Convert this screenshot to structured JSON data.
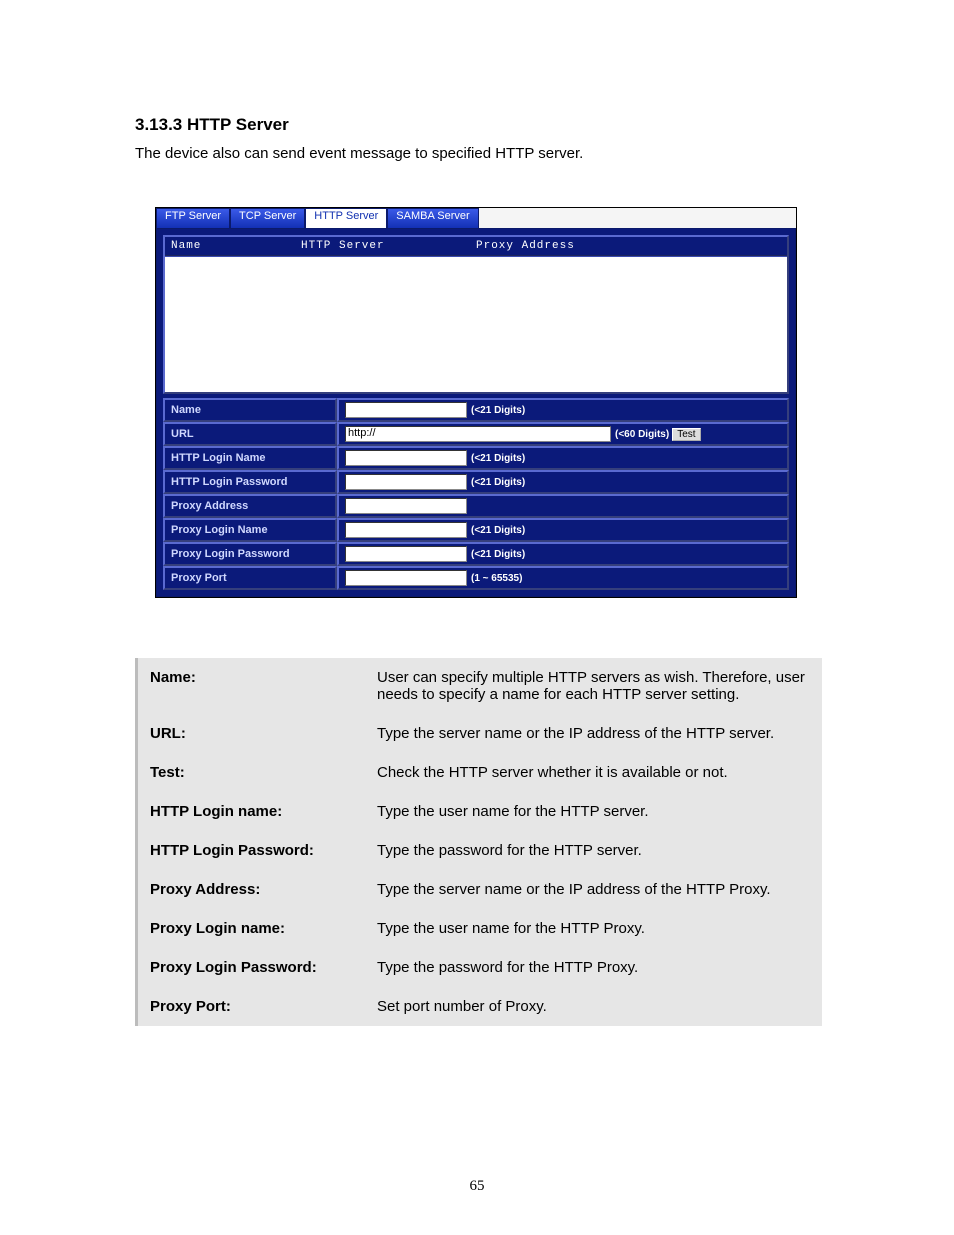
{
  "heading": "3.13.3 HTTP Server",
  "intro": "The device also can send event message to specified HTTP server.",
  "tabs": [
    "FTP Server",
    "TCP Server",
    "HTTP Server",
    "SAMBA Server"
  ],
  "active_tab_index": 2,
  "list_header": {
    "c1": "Name",
    "c2": "HTTP Server",
    "c3": "Proxy Address"
  },
  "form_rows": [
    {
      "label": "Name",
      "value": "",
      "hint": "(<21 Digits)",
      "input_w": 120
    },
    {
      "label": "URL",
      "value": "http://",
      "hint": "(<60 Digits)",
      "input_w": 260,
      "test": "Test"
    },
    {
      "label": "HTTP Login Name",
      "value": "",
      "hint": "(<21 Digits)",
      "input_w": 120
    },
    {
      "label": "HTTP Login Password",
      "value": "",
      "hint": "(<21 Digits)",
      "input_w": 120
    },
    {
      "label": "Proxy Address",
      "value": "",
      "hint": "",
      "input_w": 120
    },
    {
      "label": "Proxy Login Name",
      "value": "",
      "hint": "(<21 Digits)",
      "input_w": 120
    },
    {
      "label": "Proxy Login Password",
      "value": "",
      "hint": "(<21 Digits)",
      "input_w": 120
    },
    {
      "label": "Proxy Port",
      "value": "",
      "hint": "(1 ~ 65535)",
      "input_w": 120
    }
  ],
  "desc": [
    {
      "k": "Name:",
      "v": "User can specify multiple HTTP servers as wish. Therefore, user needs to specify a name for each HTTP server setting."
    },
    {
      "k": "URL:",
      "v": "Type the server name or the IP address of the HTTP server."
    },
    {
      "k": "Test:",
      "v": "Check the HTTP server whether it is available or not."
    },
    {
      "k": "HTTP Login name:",
      "v": "Type the user name for the HTTP server."
    },
    {
      "k": "HTTP Login Password:",
      "v": "Type the password for the HTTP server."
    },
    {
      "k": "Proxy Address:",
      "v": "Type the server name or the IP address of the HTTP Proxy."
    },
    {
      "k": "Proxy Login name:",
      "v": "Type the user name for the HTTP Proxy."
    },
    {
      "k": "Proxy Login Password:",
      "v": "Type the password for the HTTP Proxy."
    },
    {
      "k": "Proxy Port:",
      "v": "Set port number of Proxy."
    }
  ],
  "page_number": "65"
}
